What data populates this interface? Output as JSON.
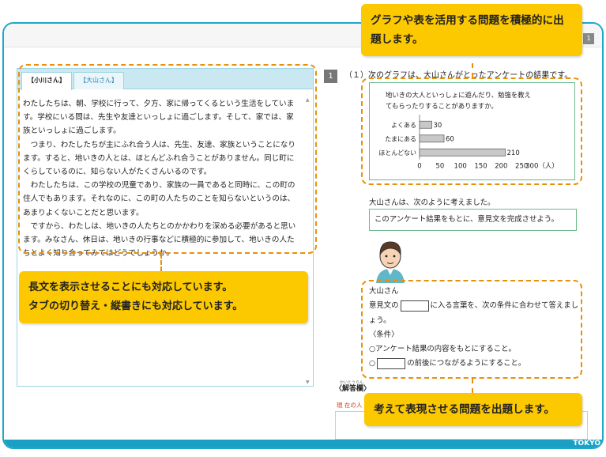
{
  "page": {
    "number": "1",
    "brand": "TOKYO"
  },
  "reading": {
    "tabs": [
      "【小川さん】",
      "【大山さん】"
    ],
    "paragraphs": [
      "わたしたちは、朝、学校に行って、夕方、家に帰ってくるという生活をしています。学校にいる間は、先生や友達といっしょに過ごします。そして、家では、家族といっしょに過ごします。",
      "つまり、わたしたちが主にふれ合う人は、先生、友達、家族ということになります。すると、地いきの人とは、ほとんどふれ合うことがありません。同じ町にくらしているのに、知らない人がたくさんいるのです。",
      "わたしたちは、この学校の児童であり、家族の一員であると同時に、この町の住人でもあります。それなのに、この町の人たちのことを知らないというのは、あまりよくないことだと思います。",
      "ですから、わたしは、地いきの人たちとのかかわりを深める必要があると思います。みなさん、休日は、地いきの行事などに積極的に参加して、地いきの人たちとよく知り合ってみてはどうでしょうか。"
    ]
  },
  "question": {
    "number": "1",
    "text": "（１）次のグラフは、大山さんがとったアンケートの結果です。",
    "lead": "大山さんは、次のように考えました。",
    "prompt": "このアンケート結果をもとに、意見文を完成させよう。",
    "speaker": "大山さん",
    "opinion_pre": "意見文の",
    "opinion_post": "に入る言葉を、次の条件に合わせて答えましょう。",
    "conditions_label": "〈条件〉",
    "condition1": "○アンケート結果の内容をもとにすること。",
    "condition2_pre": "○",
    "condition2_post": "の前後につながるようにすること。",
    "answer_label": "〈解答欄〉",
    "answer_ruby": "かいとうらん",
    "answer_sub": "現 在の人"
  },
  "chart_data": {
    "type": "bar",
    "orientation": "horizontal",
    "title": "地いきの大人といっしょに遊んだり、勉強を教えてもらったりすることがありますか。",
    "categories": [
      "よくある",
      "たまにある",
      "ほとんどない"
    ],
    "values": [
      30,
      60,
      210
    ],
    "xlim": [
      0,
      300
    ],
    "xticks": [
      "0",
      "50",
      "100",
      "150",
      "200",
      "250",
      "300（人）"
    ],
    "bar_color": "#c8c8c8"
  },
  "callouts": {
    "top": "グラフや表を活用する問題を積極的に出題します。",
    "left_line1": "長文を表示させることにも対応しています。",
    "left_line2": "タブの切り替え・縦書きにも対応しています。",
    "bottom": "考えて表現させる問題を出題します。"
  },
  "colors": {
    "accent": "#20a6c8",
    "callout": "#fcc800",
    "dash": "#e8900a",
    "frame_green": "#6fb98a"
  }
}
